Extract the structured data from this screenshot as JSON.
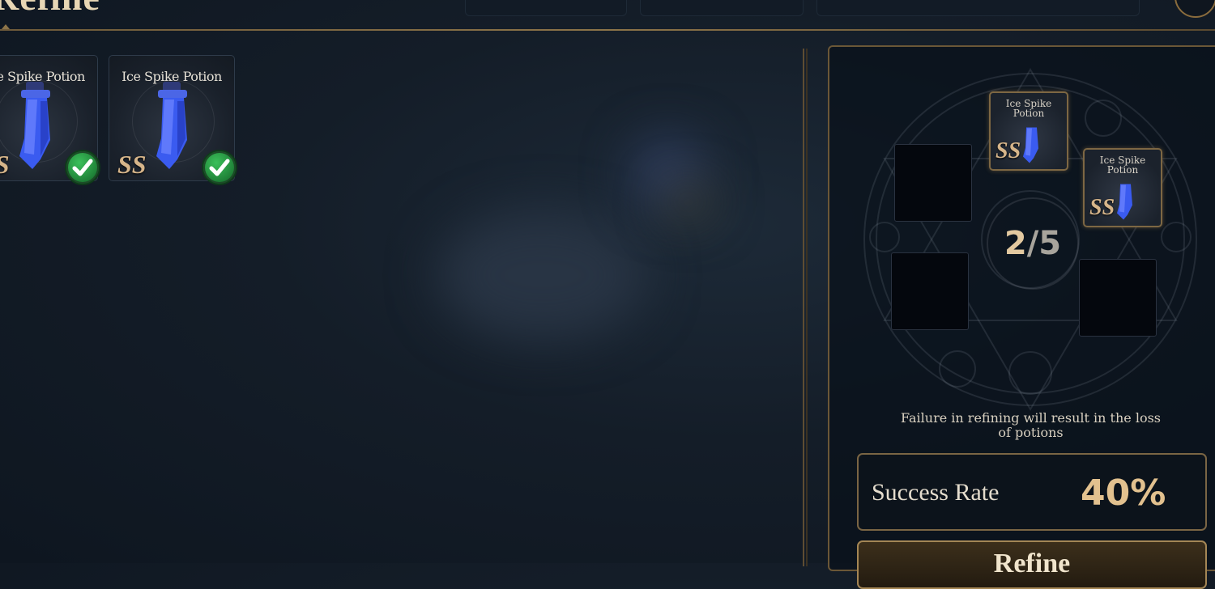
{
  "header": {
    "title": "Refine"
  },
  "inventory": {
    "items": [
      {
        "name": "Ice Spike Potion",
        "grade": "SS",
        "selected": true
      },
      {
        "name": "Ice Spike Potion",
        "grade": "SS",
        "selected": true
      }
    ]
  },
  "refine_panel": {
    "slots": [
      {
        "filled": true,
        "name": "Ice Spike Potion",
        "grade": "SS"
      },
      {
        "filled": true,
        "name": "Ice Spike Potion",
        "grade": "SS"
      },
      {
        "filled": false
      },
      {
        "filled": false
      },
      {
        "filled": false
      }
    ],
    "count_current": "2",
    "count_total": "5",
    "count_separator": "/",
    "warning": "Failure in refining will result in the loss of potions",
    "success_rate_label": "Success Rate",
    "success_rate_value": "40%",
    "refine_button_label": "Refine"
  },
  "colors": {
    "accent_gold": "#d6b58a",
    "check_green": "#2ea84a",
    "potion_blue": "#3a5bf0"
  },
  "icons": {
    "item": "ice-spike-potion-icon",
    "selected": "check-circle-icon"
  }
}
